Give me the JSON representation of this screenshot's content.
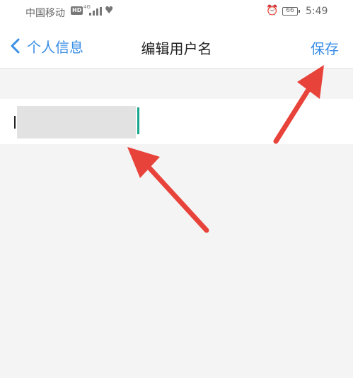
{
  "status_bar": {
    "carrier": "中国移动",
    "hd_badge": "HD",
    "network_type": "4G",
    "battery": "66",
    "time": "5:49",
    "icons": [
      "signal-icon",
      "heart-icon",
      "alarm-icon",
      "battery-icon"
    ]
  },
  "nav": {
    "back_label": "个人信息",
    "title": "编辑用户名",
    "save_label": "保存"
  },
  "input": {
    "value": ""
  },
  "colors": {
    "accent": "#3a8ee6",
    "background": "#f4f4f4",
    "arrow": "#e8433b",
    "caret": "#1aa58e"
  }
}
